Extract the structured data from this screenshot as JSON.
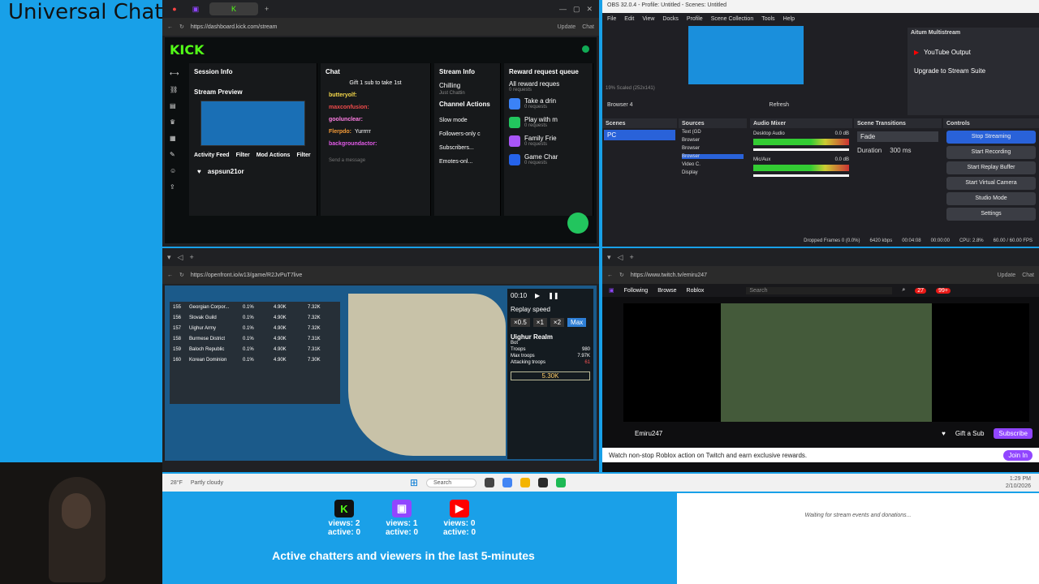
{
  "title": "Universal Chat",
  "kick_window": {
    "url": "https://dashboard.kick.com/stream",
    "update_label": "Update",
    "chat_label": "Chat",
    "logo": "KICK",
    "nav_icons": [
      "arrows-icon",
      "link-icon",
      "chart-icon",
      "trophy-icon",
      "dashboard-icon",
      "wrench-icon",
      "users-icon",
      "upload-icon"
    ],
    "session_info": "Session Info",
    "stream_preview": "Stream Preview",
    "activity_feed": "Activity Feed",
    "filter": "Filter",
    "mod_actions": "Mod Actions",
    "filter2": "Filter",
    "follower_name": "aspsun21or",
    "chat": {
      "title": "Chat",
      "gift_banner": "Gift 1 sub to take 1st",
      "messages": [
        {
          "user": "butteryolf:",
          "color": "#f6d84a"
        },
        {
          "user": "maxconfusion:",
          "color": "#f04b4b"
        },
        {
          "user": "goolunclear:",
          "color": "#ff7de3"
        },
        {
          "user": "Flerpdo:",
          "color": "#f59b37",
          "text": "Yurrrrr"
        },
        {
          "user": "backgroundactor:",
          "color": "#e15ae8"
        }
      ],
      "send_placeholder": "Send a message"
    },
    "stream_info": "Stream Info",
    "category": "Chilling",
    "stream_title": "Just Chattin",
    "channel_actions": "Channel Actions",
    "slow_mode": "Slow mode",
    "followers_only": "Followers-only c",
    "subscribers": "Subscribers...",
    "emotes_only": "Emotes-onl...",
    "reward_queue": "Reward request queue",
    "all_reward_requests": "All reward reques",
    "requests_count": "0 requests",
    "rewards": [
      {
        "title": "Take a drin",
        "count": "0 requests",
        "color": "#3b82f6"
      },
      {
        "title": "Play with m",
        "count": "0 requests",
        "color": "#22c55e"
      },
      {
        "title": "Family Frie",
        "count": "0 requests",
        "color": "#a855f7"
      },
      {
        "title": "Game Char",
        "count": "0 requests",
        "color": "#2563eb"
      }
    ]
  },
  "obs_window": {
    "title": "OBS 32.0.4 - Profile: Untitled - Scenes: Untitled",
    "menu": [
      "File",
      "Edit",
      "View",
      "Docks",
      "Profile",
      "Scene Collection",
      "Tools",
      "Help"
    ],
    "source_label": "Browser 4",
    "refresh": "Refresh",
    "scale_text": "19%  Scaled (252x141)",
    "multistream": {
      "title": "Aitum Multistream",
      "youtube": "YouTube Output",
      "upgrade": "Upgrade to Stream Suite"
    },
    "scenes_title": "Scenes",
    "scene_item": "PC",
    "sources_title": "Sources",
    "sources": [
      "Text (GD",
      "Browser",
      "Browser",
      "Browser",
      "Video C.",
      "Display"
    ],
    "mixer_title": "Audio Mixer",
    "mixer": [
      {
        "name": "Desktop Audio",
        "db": "0.0 dB"
      },
      {
        "name": "Mic/Aux",
        "db": "0.0 dB"
      }
    ],
    "transitions_title": "Scene Transitions",
    "transition": "Fade",
    "duration_label": "Duration",
    "duration": "300 ms",
    "controls_title": "Controls",
    "controls": [
      "Stop Streaming",
      "Start Recording",
      "Start Replay Buffer",
      "Start Virtual Camera",
      "Studio Mode",
      "Settings"
    ],
    "status": {
      "dropped": "Dropped Frames 0 (0.0%)",
      "bitrate": "6420 kbps",
      "live": "00:04:08",
      "rec": "00:00:00",
      "cpu": "CPU: 2.8%",
      "fps": "60.00 / 60.00 FPS"
    }
  },
  "openfront_window": {
    "url": "https://openfront.io/w13/game/R2JvPuT7live",
    "table": [
      {
        "rank": "155",
        "name": "Georgian Corpor...",
        "pct": "0.1%",
        "a": "4.90K",
        "b": "7.32K"
      },
      {
        "rank": "156",
        "name": "Slovak Guild",
        "pct": "0.1%",
        "a": "4.90K",
        "b": "7.32K"
      },
      {
        "rank": "157",
        "name": "Uighur Army",
        "pct": "0.1%",
        "a": "4.90K",
        "b": "7.32K"
      },
      {
        "rank": "158",
        "name": "Burmese District",
        "pct": "0.1%",
        "a": "4.90K",
        "b": "7.31K"
      },
      {
        "rank": "159",
        "name": "Baloch Republic",
        "pct": "0.1%",
        "a": "4.90K",
        "b": "7.31K"
      },
      {
        "rank": "160",
        "name": "Korean Dominion",
        "pct": "0.1%",
        "a": "4.90K",
        "b": "7.30K"
      }
    ],
    "timer": "00:10",
    "replay_speed": "Replay speed",
    "speeds": [
      "×0.5",
      "×1",
      "×2",
      "Max"
    ],
    "player": {
      "name": "Uighur Realm",
      "type": "Bot",
      "troops_label": "Troops",
      "troops": "980",
      "max_label": "Max troops",
      "max": "7.97K",
      "attacking_label": "Attacking troops",
      "attacking": "61",
      "gold": "5.30K",
      "stats": [
        "0",
        "0",
        "0",
        "0"
      ]
    }
  },
  "twitch_window": {
    "url": "https://www.twitch.tv/emiru247",
    "nav": [
      "Following",
      "Browse",
      "Roblox"
    ],
    "search_placeholder": "Search",
    "update_label": "Update",
    "chat_label": "Chat",
    "badge_a": "27",
    "badge_b": "99+",
    "channel": "Emiru247",
    "gift_sub": "Gift a Sub",
    "subscribe": "Subscribe",
    "banner": "Watch non-stop Roblox action on Twitch and earn exclusive rewards.",
    "join": "Join In",
    "status_url": "https://www.twitch.tv"
  },
  "taskbar": {
    "weather_temp": "28°F",
    "weather": "Partly cloudy",
    "search": "Search",
    "time": "1:29 PM",
    "date": "2/10/2026"
  },
  "platforms": [
    {
      "name": "Kick",
      "views": "views: 2",
      "active": "active: 0",
      "color": "#53fc18",
      "glyph": "K"
    },
    {
      "name": "Twitch",
      "views": "views: 1",
      "active": "active: 0",
      "color": "#9146ff",
      "glyph": "▣"
    },
    {
      "name": "YouTube",
      "views": "views: 0",
      "active": "active: 0",
      "color": "#ff0000",
      "glyph": "▶"
    }
  ],
  "active_text": "Active chatters and viewers in the last 5-minutes",
  "waiting_text": "Waiting for stream events and donations..."
}
